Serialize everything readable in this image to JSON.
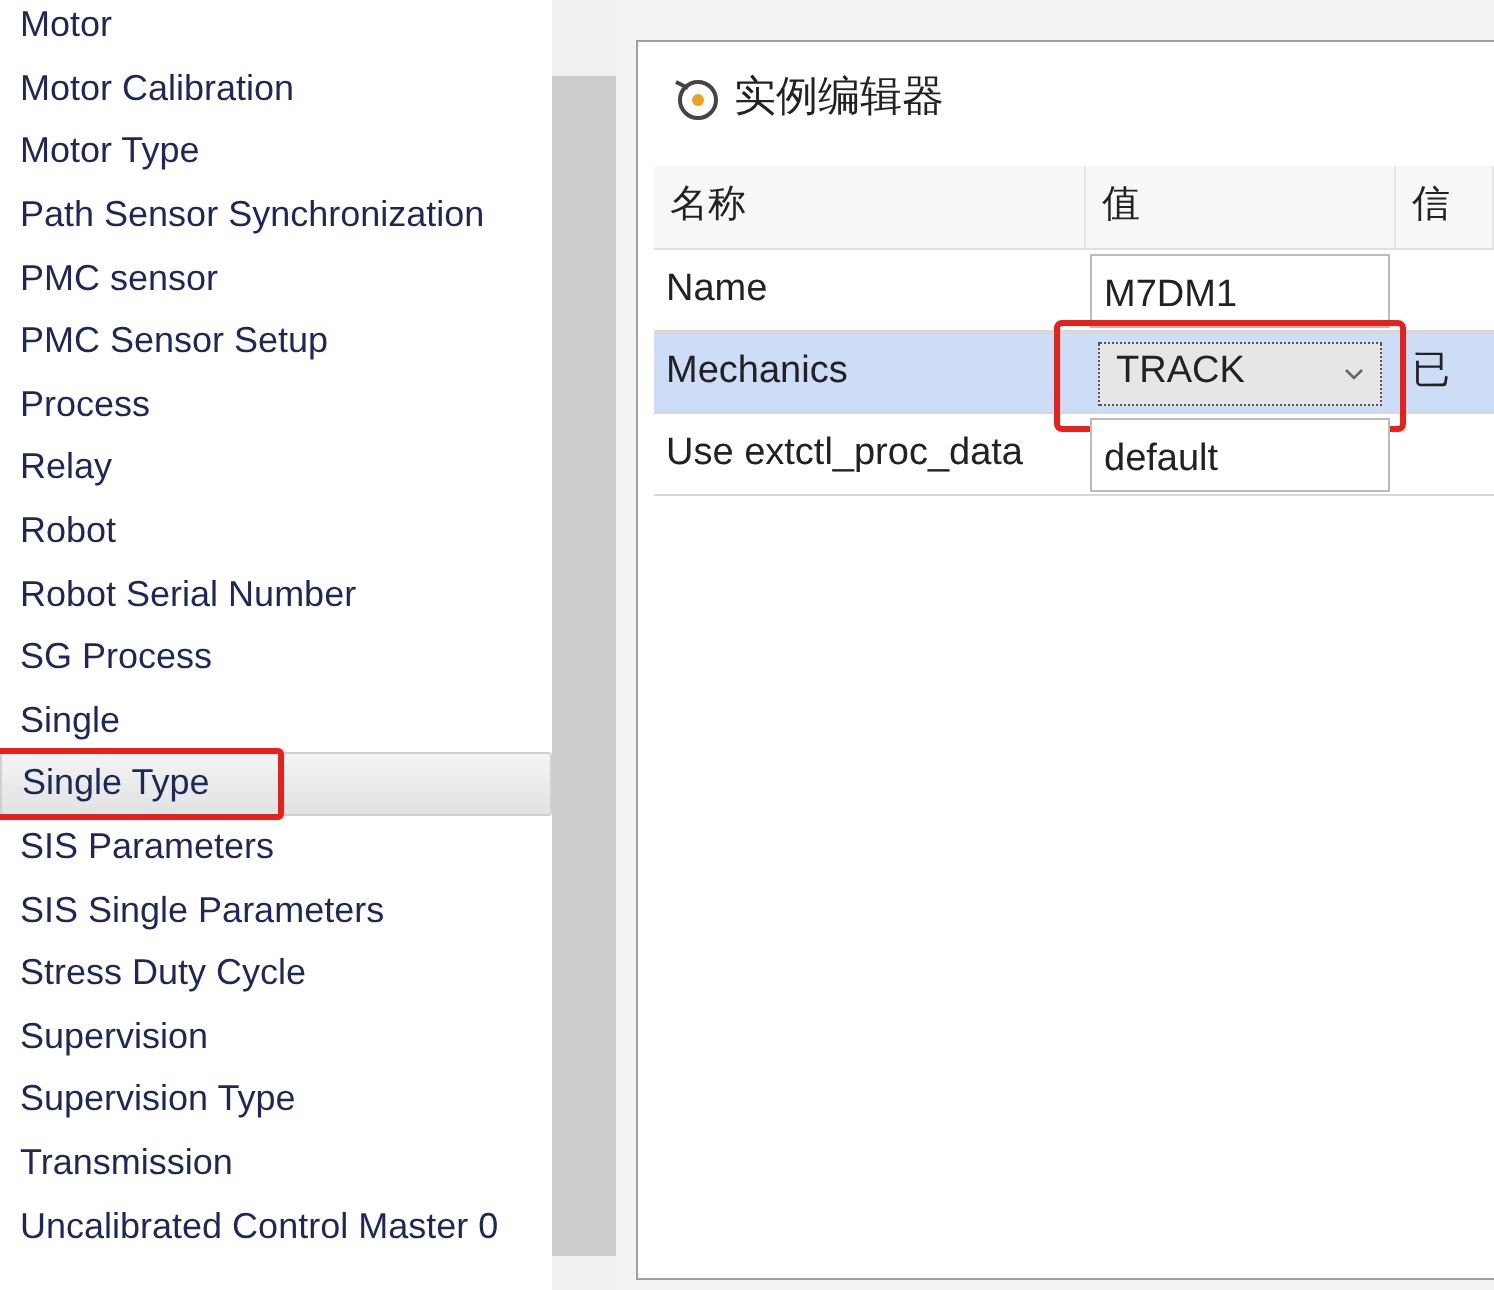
{
  "sidebar": {
    "items": [
      {
        "label": "Motor",
        "selected": false,
        "highlighted": false
      },
      {
        "label": "Motor Calibration",
        "selected": false,
        "highlighted": false
      },
      {
        "label": "Motor Type",
        "selected": false,
        "highlighted": false
      },
      {
        "label": "Path Sensor Synchronization",
        "selected": false,
        "highlighted": false
      },
      {
        "label": "PMC sensor",
        "selected": false,
        "highlighted": false
      },
      {
        "label": "PMC Sensor Setup",
        "selected": false,
        "highlighted": false
      },
      {
        "label": "Process",
        "selected": false,
        "highlighted": false
      },
      {
        "label": "Relay",
        "selected": false,
        "highlighted": false
      },
      {
        "label": "Robot",
        "selected": false,
        "highlighted": false
      },
      {
        "label": "Robot Serial Number",
        "selected": false,
        "highlighted": false
      },
      {
        "label": "SG Process",
        "selected": false,
        "highlighted": false
      },
      {
        "label": "Single",
        "selected": false,
        "highlighted": false
      },
      {
        "label": "Single Type",
        "selected": true,
        "highlighted": true
      },
      {
        "label": "SIS Parameters",
        "selected": false,
        "highlighted": false
      },
      {
        "label": "SIS Single Parameters",
        "selected": false,
        "highlighted": false
      },
      {
        "label": "Stress Duty Cycle",
        "selected": false,
        "highlighted": false
      },
      {
        "label": "Supervision",
        "selected": false,
        "highlighted": false
      },
      {
        "label": "Supervision Type",
        "selected": false,
        "highlighted": false
      },
      {
        "label": "Transmission",
        "selected": false,
        "highlighted": false
      },
      {
        "label": "Uncalibrated Control Master 0",
        "selected": false,
        "highlighted": false
      }
    ]
  },
  "editor": {
    "title": "实例编辑器",
    "table": {
      "columns": [
        "名称",
        "值",
        "信"
      ],
      "rows": [
        {
          "name": "Name",
          "value": "M7DM1",
          "kind": "text",
          "info": "",
          "selected": false,
          "highlighted": false
        },
        {
          "name": "Mechanics",
          "value": "TRACK",
          "kind": "dropdown",
          "info": "已",
          "selected": true,
          "highlighted": true
        },
        {
          "name": "Use extctl_proc_data",
          "value": "default",
          "kind": "text",
          "info": "",
          "selected": false,
          "highlighted": false
        }
      ]
    }
  }
}
